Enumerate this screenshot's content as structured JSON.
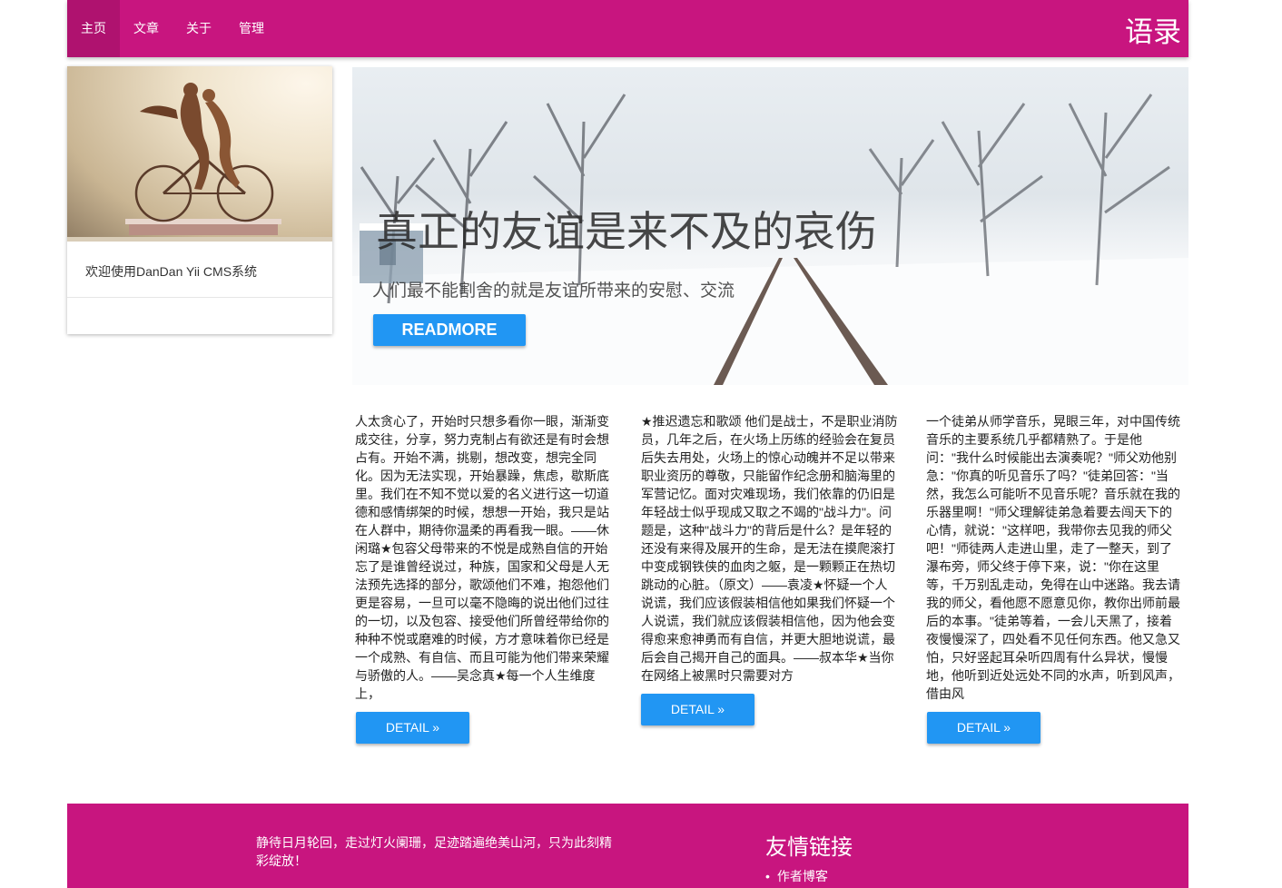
{
  "nav": {
    "items": [
      {
        "label": "主页",
        "active": true
      },
      {
        "label": "文章",
        "active": false
      },
      {
        "label": "关于",
        "active": false
      },
      {
        "label": "管理",
        "active": false
      }
    ],
    "brand": "语录"
  },
  "colors": {
    "primary": "#c8157f",
    "button": "#2196f3"
  },
  "card": {
    "image_icon": "bicycle-sculpture-image",
    "text": "欢迎使用DanDan Yii CMS系统"
  },
  "hero": {
    "title": "真正的友谊是来不及的哀伤",
    "subtitle": "人们最不能割舍的就是友谊所带来的安慰、交流",
    "button": "READMORE"
  },
  "articles": [
    {
      "text": "人太贪心了，开始时只想多看你一眼，渐渐变成交往，分享，努力克制占有欲还是有时会想占有。开始不满，挑剔，想改变，想完全同化。因为无法实现，开始暴躁，焦虑，歇斯底里。我们在不知不觉以爱的名义进行这一切道德和感情绑架的时候，想想一开始，我只是站在人群中，期待你温柔的再看我一眼。——休闲璐★包容父母带来的不悦是成熟自信的开始忘了是谁曾经说过，种族，国家和父母是人无法预先选择的部分，歌颂他们不难，抱怨他们更是容易，一旦可以毫不隐晦的说出他们过往的一切，以及包容、接受他们所曾经带给你的种种不悦或磨难的时候，方才意味着你已经是一个成熟、有自信、而且可能为他们带来荣耀与骄傲的人。——吴念真★每一个人生维度上，",
      "button": "DETAIL »"
    },
    {
      "text": "★推迟遗忘和歌颂 他们是战士，不是职业消防员，几年之后，在火场上历练的经验会在复员后失去用处，火场上的惊心动魄并不足以带来职业资历的尊敬，只能留作纪念册和脑海里的军营记忆。面对灾难现场，我们依靠的仍旧是年轻战士似乎现成又取之不竭的\"战斗力\"。问题是，这种\"战斗力\"的背后是什么？是年轻的还没有来得及展开的生命，是无法在摸爬滚打中变成钢铁侠的血肉之躯，是一颗颗正在热切跳动的心脏。（原文）——袁凌★怀疑一个人说谎，我们应该假装相信他如果我们怀疑一个人说谎，我们就应该假装相信他，因为他会变得愈来愈神勇而有自信，并更大胆地说谎，最后会自己揭开自己的面具。——叔本华★当你在网络上被黑时只需要对方",
      "button": "DETAIL »"
    },
    {
      "text": "一个徒弟从师学音乐，晃眼三年，对中国传统音乐的主要系统几乎都精熟了。于是他问：\"我什么时候能出去演奏呢？\"师父劝他别急：\"你真的听见音乐了吗？\"徒弟回答：\"当然，我怎么可能听不见音乐呢？音乐就在我的乐器里啊！\"师父理解徒弟急着要去闯天下的心情，就说：\"这样吧，我带你去见我的师父吧！\"师徒两人走进山里，走了一整天，到了瀑布旁，师父终于停下来，说：\"你在这里等，千万别乱走动，免得在山中迷路。我去请我的师父，看他愿不愿意见你，教你出师前最后的本事。\"徒弟等着，一会儿天黑了，接着夜慢慢深了，四处看不见任何东西。他又急又怕，只好竖起耳朵听四周有什么异状，慢慢地，他听到近处远处不同的水声，听到风声，借由风",
      "button": "DETAIL »"
    }
  ],
  "footer": {
    "quote": "静待日月轮回，走过灯火阑珊，足迹踏遍绝美山河，只为此刻精彩绽放！",
    "links_heading": "友情链接",
    "links": [
      "作者博客"
    ]
  }
}
